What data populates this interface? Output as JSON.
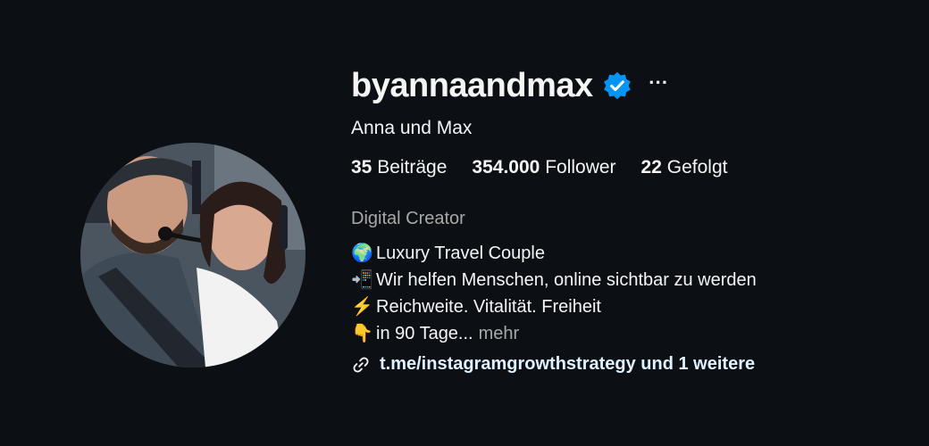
{
  "profile": {
    "username": "byannaandmax",
    "full_name": "Anna und Max",
    "more_icon": "⋯",
    "verified_icon": "verified-badge-icon",
    "accent_color": "#0095f6"
  },
  "stats": {
    "posts_count": "35",
    "posts_label": "Beiträge",
    "followers_count": "354.000",
    "followers_label": "Follower",
    "following_count": "22",
    "following_label": "Gefolgt"
  },
  "bio": {
    "category": "Digital Creator",
    "lines": [
      {
        "icon": "🌍",
        "text": "Luxury Travel Couple"
      },
      {
        "icon": "📲",
        "text": "Wir helfen Menschen, online sichtbar zu werden"
      },
      {
        "icon": "⚡",
        "text": "Reichweite. Vitalität. Freiheit"
      },
      {
        "icon": "👇",
        "text": "in 90 Tage..."
      }
    ],
    "more_label": "mehr",
    "link_text": "t.me/instagramgrowthstrategy und 1 weitere"
  }
}
